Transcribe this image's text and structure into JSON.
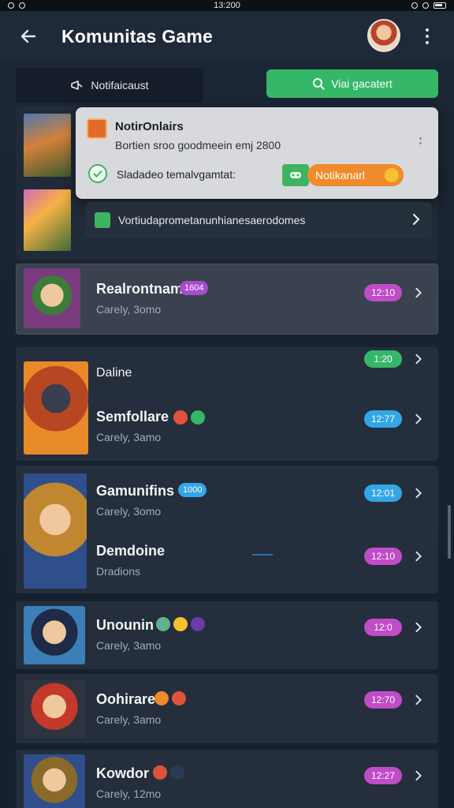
{
  "status_bar": {
    "time": "13:200"
  },
  "header": {
    "title": "Komunitas Game"
  },
  "actions": {
    "notif_tab": "Notifaicaust",
    "visit_button": "Viai gacatert"
  },
  "popup": {
    "title": "NotirOnlairs",
    "subtitle": "Bortien sroo goodmeein emj 2800",
    "line": "Sladadeo temalvgamtat:",
    "action_label": "Notikanarl"
  },
  "dark_bar": {
    "label": "Vortiudaprometanunhianesaerodomes"
  },
  "rows": [
    {
      "name": "Realrontnam:",
      "pill": "1604",
      "sub": "Carely, 3omo",
      "badge": "12:10"
    },
    {
      "name": "Daline",
      "sub": "",
      "badge": "1:20"
    },
    {
      "name": "Semfollare",
      "sub": "Carely, 3amo",
      "badge": "12:77"
    },
    {
      "name": "Gamunifins",
      "pill": "1000",
      "sub": "Carely, 3omo",
      "badge": "12:01"
    },
    {
      "name": "Demdoine",
      "sub": "Dradions",
      "badge": "12:10"
    },
    {
      "name": "Unounin",
      "sub": "Carely, 3amo",
      "badge": "12:0"
    },
    {
      "name": "Oohirare",
      "sub": "Carely, 3amo",
      "badge": "12:70"
    },
    {
      "name": "Kowdor",
      "sub": "Carely, 12mo",
      "badge": "12:27"
    }
  ],
  "colors": {
    "green": "#35b76a",
    "orange": "#f08a2a",
    "magenta": "#c04cc8",
    "blue": "#33a6e6"
  }
}
